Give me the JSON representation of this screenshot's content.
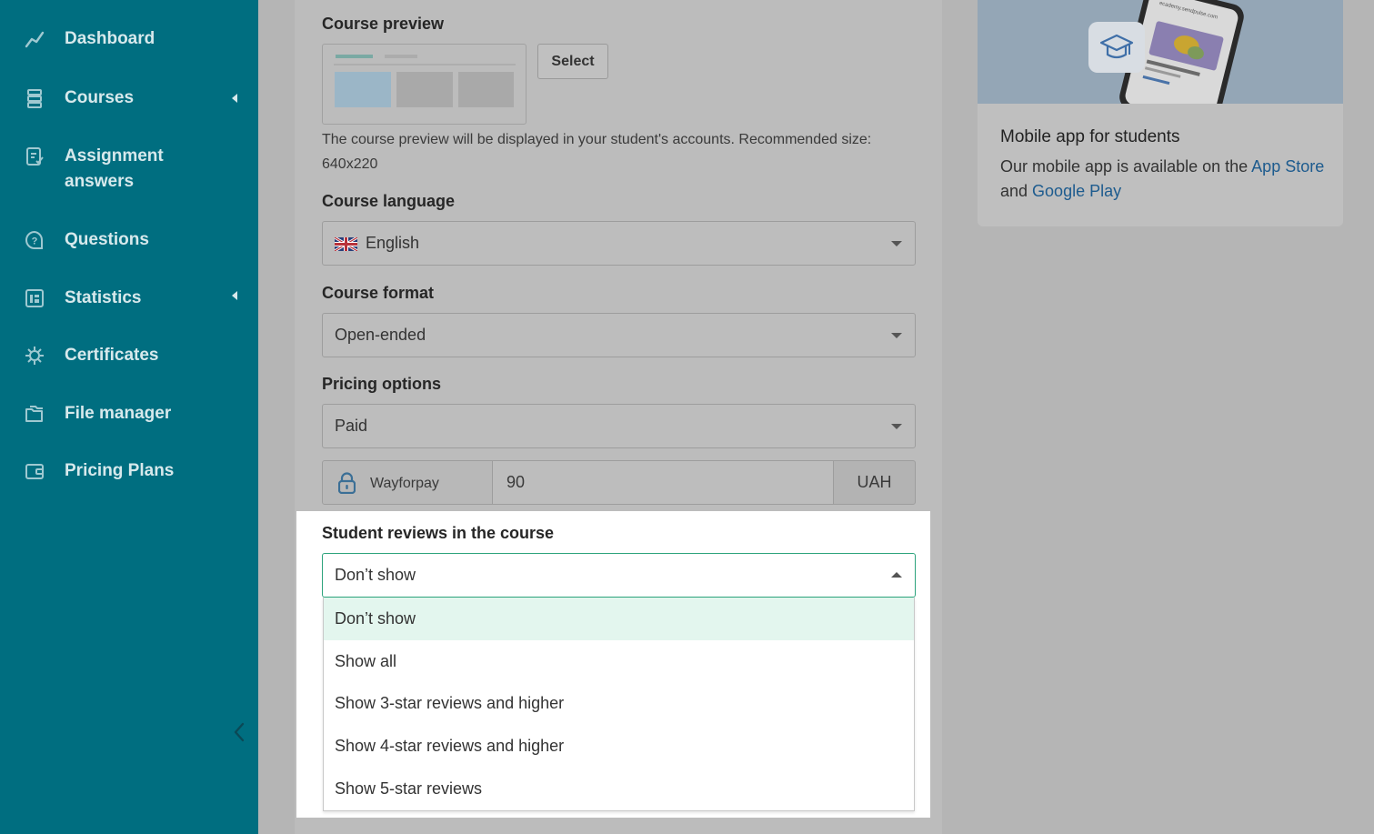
{
  "sidebar": {
    "items": [
      {
        "label": "Dashboard",
        "icon": "chart-line-icon"
      },
      {
        "label": "Courses",
        "icon": "courses-stack-icon",
        "has_submenu": true
      },
      {
        "label": "Assignment answers",
        "label_line1": "Assignment",
        "label_line2": "answers",
        "icon": "assignment-doc-icon"
      },
      {
        "label": "Questions",
        "icon": "question-bubble-icon"
      },
      {
        "label": "Statistics",
        "icon": "statistics-panel-icon",
        "has_submenu": true
      },
      {
        "label": "Certificates",
        "icon": "certificate-gear-icon"
      },
      {
        "label": "File manager",
        "icon": "folder-files-icon"
      },
      {
        "label": "Pricing Plans",
        "icon": "wallet-icon"
      }
    ],
    "collapse_icon": "chevron-left-icon"
  },
  "form": {
    "course_preview": {
      "label": "Course preview",
      "select_button": "Select",
      "hint": "The course preview will be displayed in your student's accounts. Recommended size: 640x220"
    },
    "course_language": {
      "label": "Course language",
      "value": "English",
      "flag_icon": "uk-flag-icon"
    },
    "course_format": {
      "label": "Course format",
      "value": "Open-ended"
    },
    "pricing_options": {
      "label": "Pricing options",
      "value": "Paid",
      "payment_method": "Wayforpay",
      "payment_icon": "lock-icon",
      "amount": "90",
      "currency": "UAH"
    },
    "student_reviews": {
      "label": "Student reviews in the course",
      "value": "Don’t show",
      "options": [
        "Don’t show",
        "Show all",
        "Show 3-star reviews and higher",
        "Show 4-star reviews and higher",
        "Show 5-star reviews"
      ],
      "selected_index": 0
    }
  },
  "app_promo": {
    "phone_url_text": "ecademy.sendpulse.com",
    "title": "Mobile app for students",
    "text_before": "Our mobile app is available on the ",
    "link_app_store": "App Store",
    "text_and": " and ",
    "link_google_play": "Google Play"
  },
  "colors": {
    "sidebar_bg": "#006e80",
    "accent_green": "#2ca37c",
    "selected_option_bg": "#e3f6ee",
    "link": "#1d5b8e"
  }
}
